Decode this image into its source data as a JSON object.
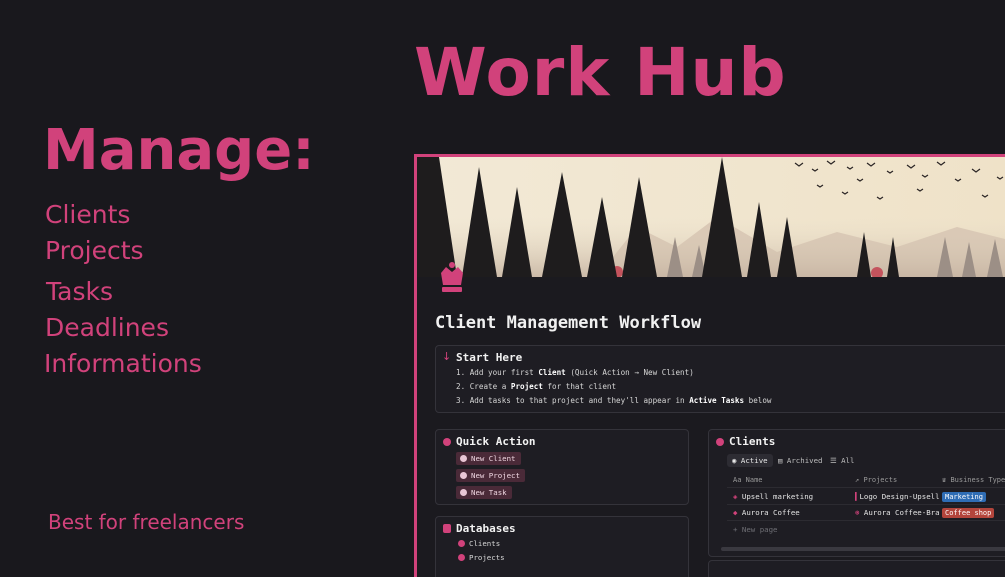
{
  "hero": {
    "title": "Work Hub"
  },
  "left": {
    "heading": "Manage:",
    "features": [
      "Clients",
      "Projects",
      "Tasks",
      "Deadlines",
      "Informations"
    ],
    "tagline": "Best for freelancers"
  },
  "colors": {
    "accent": "#d1427b",
    "background": "#19181d",
    "panel": "#1e1d23"
  },
  "app": {
    "page_title": "Client Management Workflow",
    "page_icon": "crown-icon",
    "start_here": {
      "title": "Start Here",
      "steps": [
        {
          "num": "1.",
          "pre": "Add your first ",
          "bold": "Client",
          "post": " (Quick Action → New Client)"
        },
        {
          "num": "2.",
          "pre": "Create a ",
          "bold": "Project",
          "post": " for that client"
        },
        {
          "num": "3.",
          "pre": "Add tasks to that project and they'll appear in ",
          "bold": "Active Tasks",
          "post": " below"
        }
      ]
    },
    "quick_action": {
      "title": "Quick Action",
      "buttons": [
        "New Client",
        "New Project",
        "New Task"
      ]
    },
    "databases": {
      "title": "Databases",
      "items": [
        "Clients",
        "Projects"
      ]
    },
    "clients": {
      "title": "Clients",
      "tabs": [
        "Active",
        "Archived",
        "All"
      ],
      "columns": [
        "Name",
        "Projects",
        "Business Type"
      ],
      "rows": [
        {
          "name": "Upsell marketing",
          "project": "Logo Design-Upsell",
          "type": "Marketing",
          "type_color": "#2f6db5"
        },
        {
          "name": "Aurora Coffee",
          "project": "Aurora Coffee-Brand",
          "type": "Coffee shop",
          "type_color": "#b3453c"
        }
      ],
      "new_page": "+ New page"
    }
  }
}
